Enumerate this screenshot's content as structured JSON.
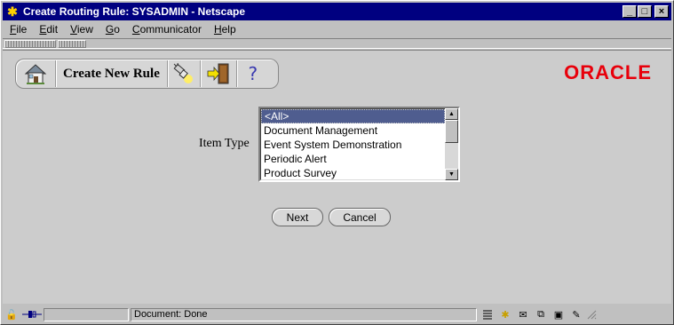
{
  "window": {
    "title": "Create Routing Rule: SYSADMIN - Netscape",
    "minimize": "_",
    "maximize": "□",
    "close": "×"
  },
  "menu": [
    {
      "key": "F",
      "rest": "ile"
    },
    {
      "key": "E",
      "rest": "dit"
    },
    {
      "key": "V",
      "rest": "iew"
    },
    {
      "key": "G",
      "rest": "o"
    },
    {
      "key": "C",
      "rest": "ommunicator"
    },
    {
      "key": "H",
      "rest": "elp"
    }
  ],
  "toolbar": {
    "create_label": "Create New Rule",
    "help_label": "?"
  },
  "brand": {
    "logo_text": "ORACLE",
    "color": "#e8000b"
  },
  "form": {
    "item_type_label": "Item Type",
    "options": [
      "<All>",
      "Document Management",
      "Event System Demonstration",
      "Periodic Alert",
      "Product Survey"
    ],
    "selected": "<All>"
  },
  "buttons": {
    "next": "Next",
    "cancel": "Cancel"
  },
  "status": {
    "text": "Document: Done"
  }
}
